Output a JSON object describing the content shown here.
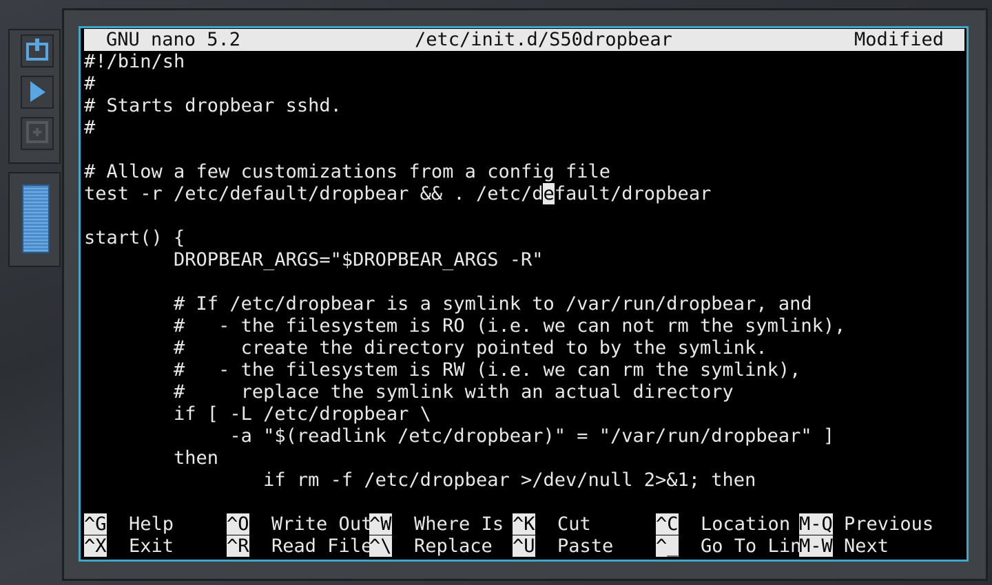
{
  "sidebar": {
    "buttons": [
      {
        "icon": "power-icon"
      },
      {
        "icon": "play-icon"
      },
      {
        "icon": "maximize-icon"
      }
    ],
    "slider": {
      "icon": "scroll-slider"
    }
  },
  "nano": {
    "app_version": "GNU nano 5.2",
    "filename": "/etc/init.d/S50dropbear",
    "status": "Modified",
    "lines": [
      "#!/bin/sh",
      "#",
      "# Starts dropbear sshd.",
      "#",
      "",
      "# Allow a few customizations from a config file",
      "test -r /etc/default/dropbear && . /etc/d",
      "",
      "start() {",
      "        DROPBEAR_ARGS=\"$DROPBEAR_ARGS -R\"",
      "",
      "        # If /etc/dropbear is a symlink to /var/run/dropbear, and",
      "        #   - the filesystem is RO (i.e. we can not rm the symlink),",
      "        #     create the directory pointed to by the symlink.",
      "        #   - the filesystem is RW (i.e. we can rm the symlink),",
      "        #     replace the symlink with an actual directory",
      "        if [ -L /etc/dropbear \\",
      "             -a \"$(readlink /etc/dropbear)\" = \"/var/run/dropbear\" ]",
      "        then",
      "                if rm -f /etc/dropbear >/dev/null 2>&1; then"
    ],
    "cursor_line_before": "test -r /etc/default/dropbear && . /etc/d",
    "cursor_char": "e",
    "cursor_line_after": "fault/dropbear",
    "shortcuts_row1": [
      {
        "key": "^G",
        "label": "Help"
      },
      {
        "key": "^O",
        "label": "Write Out"
      },
      {
        "key": "^W",
        "label": "Where Is"
      },
      {
        "key": "^K",
        "label": "Cut"
      },
      {
        "key": "^C",
        "label": "Location"
      },
      {
        "key": "M-Q",
        "label": "Previous"
      }
    ],
    "shortcuts_row2": [
      {
        "key": "^X",
        "label": "Exit"
      },
      {
        "key": "^R",
        "label": "Read File"
      },
      {
        "key": "^\\",
        "label": "Replace"
      },
      {
        "key": "^U",
        "label": "Paste"
      },
      {
        "key": "^_",
        "label": "Go To Line"
      },
      {
        "key": "M-W",
        "label": "Next"
      }
    ]
  },
  "colors": {
    "terminal_bg": "#000000",
    "terminal_fg": "#e8e8e8",
    "frame_accent": "#3fa7c9"
  }
}
